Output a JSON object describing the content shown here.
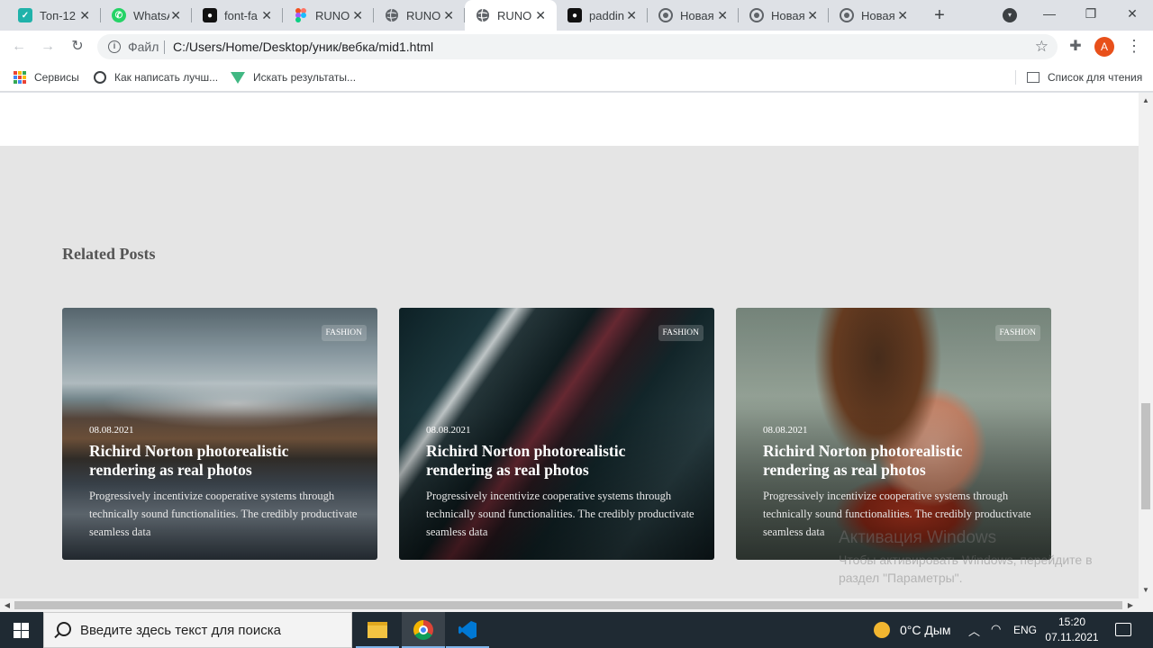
{
  "browser": {
    "tabs": [
      {
        "title": "Топ-12",
        "icon": "teal-check-icon",
        "color": "#20b2aa"
      },
      {
        "title": "WhatsApp",
        "icon": "whatsapp-icon",
        "color": "#25d366"
      },
      {
        "title": "font-fa",
        "icon": "github-icon",
        "color": "#111111"
      },
      {
        "title": "RUNO",
        "icon": "figma-icon",
        "color": "#f24e1e"
      },
      {
        "title": "RUNO",
        "icon": "globe-icon",
        "color": "#5f6368"
      },
      {
        "title": "RUNO",
        "icon": "globe-icon",
        "color": "#5f6368",
        "active": true
      },
      {
        "title": "paddin",
        "icon": "github-icon",
        "color": "#111111"
      },
      {
        "title": "Новая",
        "icon": "chrome-icon",
        "color": "#5f6368"
      },
      {
        "title": "Новая",
        "icon": "chrome-icon",
        "color": "#5f6368"
      },
      {
        "title": "Новая",
        "icon": "chrome-icon",
        "color": "#5f6368"
      }
    ],
    "address": {
      "scheme_label": "Файл",
      "url": "C:/Users/Home/Desktop/уник/вебка/mid1.html"
    },
    "profile_initial": "A",
    "bookmarks": [
      {
        "label": "Сервисы",
        "icon": "apps-grid-icon"
      },
      {
        "label": "Как написать лучш...",
        "icon": "opera-icon"
      },
      {
        "label": "Искать результаты...",
        "icon": "vue-icon"
      }
    ],
    "reading_list": "Список для чтения"
  },
  "page": {
    "section_title": "Related Posts",
    "posts": [
      {
        "badge": "FASHION",
        "date": "08.08.2021",
        "title": "Richird Norton photorealistic rendering as real photos",
        "excerpt": "Progressively incentivize cooperative systems through technically sound functionalities. The credibly productivate seamless data",
        "image": "mountain-lake"
      },
      {
        "badge": "FASHION",
        "date": "08.08.2021",
        "title": "Richird Norton photorealistic rendering as real photos",
        "excerpt": "Progressively incentivize cooperative systems through technically sound functionalities. The credibly productivate seamless data",
        "image": "car-detail"
      },
      {
        "badge": "FASHION",
        "date": "08.08.2021",
        "title": "Richird Norton photorealistic rendering as real photos",
        "excerpt": "Progressively incentivize cooperative systems through technically sound functionalities. The credibly productivate seamless data",
        "image": "woman-hair"
      }
    ],
    "watermark": {
      "line1": "Активация Windows",
      "line2": "Чтобы активировать Windows, перейдите в раздел \"Параметры\"."
    }
  },
  "taskbar": {
    "search_placeholder": "Введите здесь текст для поиска",
    "weather": "0°C  Дым",
    "language": "ENG",
    "time": "15:20",
    "date": "07.11.2021"
  }
}
